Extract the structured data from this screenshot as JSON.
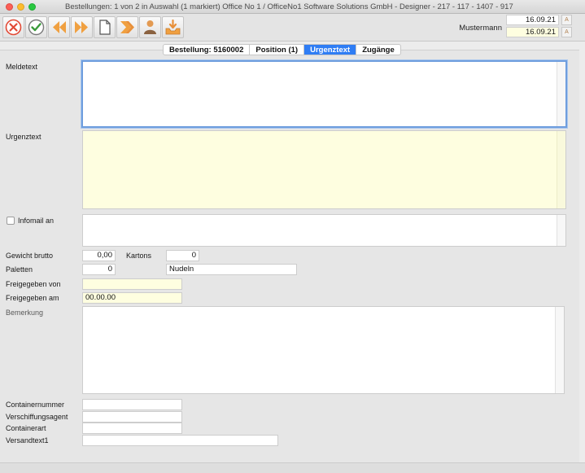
{
  "window": {
    "title": "Bestellungen: 1 von 2 in Auswahl  (1 markiert) Office No 1 /  OfficeNo1 Software Solutions GmbH - Designer - 217 - 117 - 1407 - 917"
  },
  "toolbar": {
    "buttons": [
      {
        "icon": "cancel-icon"
      },
      {
        "icon": "confirm-icon"
      },
      {
        "icon": "first-record-icon"
      },
      {
        "icon": "next-record-icon"
      },
      {
        "icon": "new-document-icon"
      },
      {
        "icon": "last-record-icon"
      },
      {
        "icon": "user-icon"
      },
      {
        "icon": "inbox-download-icon"
      }
    ],
    "accent_orange": "#f0a040",
    "accent_red": "#e24a36",
    "accent_green": "#3a9a3a"
  },
  "header": {
    "user": "Mustermann",
    "date1": "16.09.21",
    "date2": "16.09.21"
  },
  "tabs": [
    {
      "label": "Bestellung: 5160002",
      "active": false
    },
    {
      "label": "Position (1)",
      "active": false
    },
    {
      "label": "Urgenztext",
      "active": true
    },
    {
      "label": "Zugänge",
      "active": false
    }
  ],
  "form": {
    "meldetext_label": "Meldetext",
    "meldetext_value": "",
    "urgenztext_label": "Urgenztext",
    "urgenztext_value": "",
    "infomail_label": "Infomail an",
    "infomail_checked": false,
    "infomail_value": "",
    "gewicht_label": "Gewicht brutto",
    "gewicht_value": "0,00",
    "kartons_label": "Kartons",
    "kartons_value": "0",
    "paletten_label": "Paletten",
    "paletten_value": "0",
    "nudeln_value": "Nudeln",
    "freigegeben_von_label": "Freigegeben von",
    "freigegeben_von_value": "",
    "freigegeben_am_label": "Freigegeben am",
    "freigegeben_am_value": "00.00.00",
    "bemerkung_label": "Bemerkung",
    "bemerkung_value": "",
    "containernummer_label": "Containernummer",
    "containernummer_value": "",
    "verschiffungsagent_label": "Verschiffungsagent",
    "verschiffungsagent_value": "",
    "containerart_label": "Containerart",
    "containerart_value": "",
    "versandtext_label": "Versandtext1",
    "versandtext_value": ""
  }
}
